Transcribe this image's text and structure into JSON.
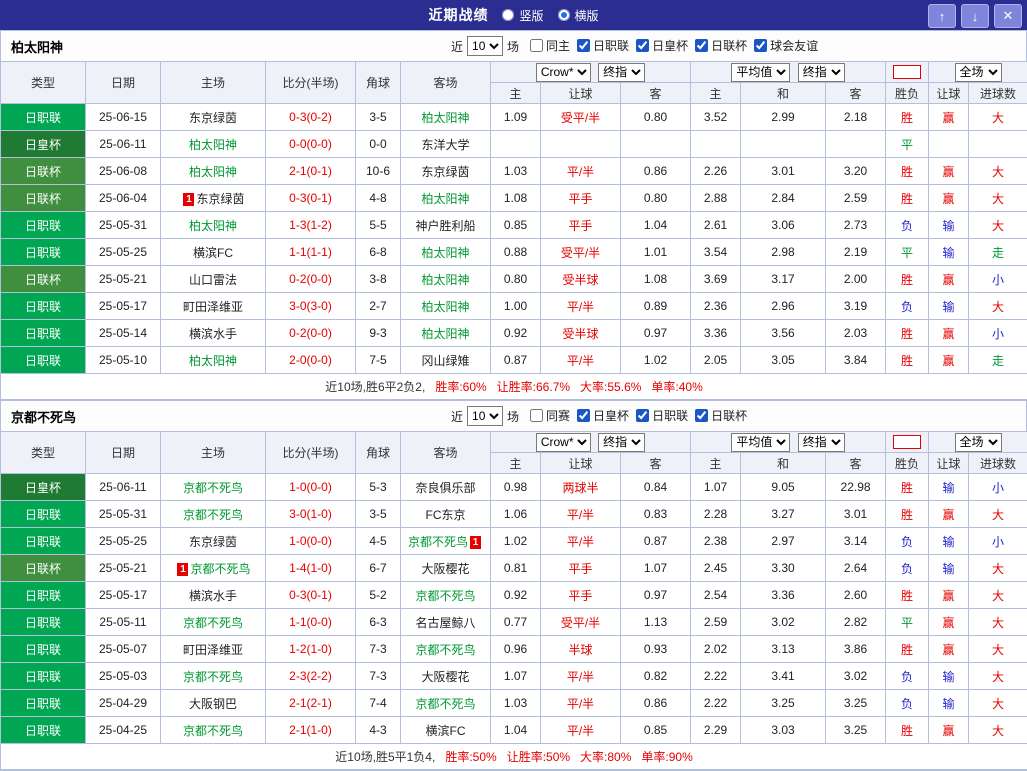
{
  "titlebar": {
    "title": "近期战绩",
    "vertical_label": "竖版",
    "horizontal_label": "横版",
    "up_icon": "↑",
    "down_icon": "↓",
    "close_icon": "✕"
  },
  "filter_labels": {
    "near": "近",
    "matches": "场"
  },
  "table_header": {
    "col_type": "类型",
    "col_date": "日期",
    "col_home": "主场",
    "col_score": "比分(半场)",
    "col_corner": "角球",
    "col_away": "客场",
    "odds_source": "Crow*",
    "odds_stage": "终指",
    "avg_source": "平均值",
    "avg_stage": "终指",
    "scope": "全场",
    "sub_home": "主",
    "sub_handicap": "让球",
    "sub_away": "客",
    "sub_home2": "主",
    "sub_draw": "和",
    "sub_away2": "客",
    "col_result": "胜负",
    "col_handicap_result": "让球",
    "col_goals": "进球数"
  },
  "badge_text": "1",
  "colors": {
    "text": "#222222",
    "league": {
      "日职联": "#00a651",
      "日皇杯": "#1f7a33",
      "日联杯": "#3f8f3f"
    },
    "focus_team": "#009933",
    "team": "#222222",
    "score": "#e60000",
    "handicap_line": "#e60000",
    "result": {
      "胜": "#e60000",
      "平": "#009933",
      "负": "#2323cc"
    },
    "cover": {
      "赢": "#e60000",
      "输": "#2323cc"
    },
    "goals": {
      "大": "#e60000",
      "小": "#2323cc",
      "走": "#009933"
    }
  },
  "sections": [
    {
      "team": "柏太阳神",
      "filter": {
        "count": "10",
        "checkboxes": [
          {
            "label": "同主",
            "checked": false
          },
          {
            "label": "日职联",
            "checked": true
          },
          {
            "label": "日皇杯",
            "checked": true
          },
          {
            "label": "日联杯",
            "checked": true
          },
          {
            "label": "球会友谊",
            "checked": true
          }
        ]
      },
      "rows": [
        {
          "league": "日职联",
          "date": "25-06-15",
          "home": "东京绿茵",
          "home_focus": false,
          "home_badge": null,
          "score": "0-3(0-2)",
          "corners": "3-5",
          "away": "柏太阳神",
          "away_focus": true,
          "away_badge": null,
          "odds": [
            "1.09",
            "受平/半",
            "0.80"
          ],
          "avg": [
            "3.52",
            "2.99",
            "2.18"
          ],
          "result": "胜",
          "cover": "赢",
          "goals": "大"
        },
        {
          "league": "日皇杯",
          "date": "25-06-11",
          "home": "柏太阳神",
          "home_focus": true,
          "home_badge": null,
          "score": "0-0(0-0)",
          "corners": "0-0",
          "away": "东洋大学",
          "away_focus": false,
          "away_badge": null,
          "odds": [
            "",
            "",
            ""
          ],
          "avg": [
            "",
            "",
            ""
          ],
          "result": "平",
          "cover": "",
          "goals": ""
        },
        {
          "league": "日联杯",
          "date": "25-06-08",
          "home": "柏太阳神",
          "home_focus": true,
          "home_badge": null,
          "score": "2-1(0-1)",
          "corners": "10-6",
          "away": "东京绿茵",
          "away_focus": false,
          "away_badge": null,
          "odds": [
            "1.03",
            "平/半",
            "0.86"
          ],
          "avg": [
            "2.26",
            "3.01",
            "3.20"
          ],
          "result": "胜",
          "cover": "赢",
          "goals": "大"
        },
        {
          "league": "日联杯",
          "date": "25-06-04",
          "home": "东京绿茵",
          "home_focus": false,
          "home_badge": "before",
          "score": "0-3(0-1)",
          "corners": "4-8",
          "away": "柏太阳神",
          "away_focus": true,
          "away_badge": null,
          "odds": [
            "1.08",
            "平手",
            "0.80"
          ],
          "avg": [
            "2.88",
            "2.84",
            "2.59"
          ],
          "result": "胜",
          "cover": "赢",
          "goals": "大"
        },
        {
          "league": "日职联",
          "date": "25-05-31",
          "home": "柏太阳神",
          "home_focus": true,
          "home_badge": null,
          "score": "1-3(1-2)",
          "corners": "5-5",
          "away": "神户胜利船",
          "away_focus": false,
          "away_badge": null,
          "odds": [
            "0.85",
            "平手",
            "1.04"
          ],
          "avg": [
            "2.61",
            "3.06",
            "2.73"
          ],
          "result": "负",
          "cover": "输",
          "goals": "大"
        },
        {
          "league": "日职联",
          "date": "25-05-25",
          "home": "横滨FC",
          "home_focus": false,
          "home_badge": null,
          "score": "1-1(1-1)",
          "corners": "6-8",
          "away": "柏太阳神",
          "away_focus": true,
          "away_badge": null,
          "odds": [
            "0.88",
            "受平/半",
            "1.01"
          ],
          "avg": [
            "3.54",
            "2.98",
            "2.19"
          ],
          "result": "平",
          "cover": "输",
          "goals": "走"
        },
        {
          "league": "日联杯",
          "date": "25-05-21",
          "home": "山口雷法",
          "home_focus": false,
          "home_badge": null,
          "score": "0-2(0-0)",
          "corners": "3-8",
          "away": "柏太阳神",
          "away_focus": true,
          "away_badge": null,
          "odds": [
            "0.80",
            "受半球",
            "1.08"
          ],
          "avg": [
            "3.69",
            "3.17",
            "2.00"
          ],
          "result": "胜",
          "cover": "赢",
          "goals": "小"
        },
        {
          "league": "日职联",
          "date": "25-05-17",
          "home": "町田泽维亚",
          "home_focus": false,
          "home_badge": null,
          "score": "3-0(3-0)",
          "corners": "2-7",
          "away": "柏太阳神",
          "away_focus": true,
          "away_badge": null,
          "odds": [
            "1.00",
            "平/半",
            "0.89"
          ],
          "avg": [
            "2.36",
            "2.96",
            "3.19"
          ],
          "result": "负",
          "cover": "输",
          "goals": "大"
        },
        {
          "league": "日职联",
          "date": "25-05-14",
          "home": "横滨水手",
          "home_focus": false,
          "home_badge": null,
          "score": "0-2(0-0)",
          "corners": "9-3",
          "away": "柏太阳神",
          "away_focus": true,
          "away_badge": null,
          "odds": [
            "0.92",
            "受半球",
            "0.97"
          ],
          "avg": [
            "3.36",
            "3.56",
            "2.03"
          ],
          "result": "胜",
          "cover": "赢",
          "goals": "小"
        },
        {
          "league": "日职联",
          "date": "25-05-10",
          "home": "柏太阳神",
          "home_focus": true,
          "home_badge": null,
          "score": "2-0(0-0)",
          "corners": "7-5",
          "away": "冈山绿雉",
          "away_focus": false,
          "away_badge": null,
          "odds": [
            "0.87",
            "平/半",
            "1.02"
          ],
          "avg": [
            "2.05",
            "3.05",
            "3.84"
          ],
          "result": "胜",
          "cover": "赢",
          "goals": "走"
        }
      ],
      "summary": {
        "prefix": "近10场,胜6平2负2,",
        "stats": [
          "胜率:60%",
          "让胜率:66.7%",
          "大率:55.6%",
          "单率:40%"
        ]
      }
    },
    {
      "team": "京都不死鸟",
      "filter": {
        "count": "10",
        "checkboxes": [
          {
            "label": "同赛",
            "checked": false
          },
          {
            "label": "日皇杯",
            "checked": true
          },
          {
            "label": "日职联",
            "checked": true
          },
          {
            "label": "日联杯",
            "checked": true
          }
        ]
      },
      "rows": [
        {
          "league": "日皇杯",
          "date": "25-06-11",
          "home": "京都不死鸟",
          "home_focus": true,
          "home_badge": null,
          "score": "1-0(0-0)",
          "corners": "5-3",
          "away": "奈良俱乐部",
          "away_focus": false,
          "away_badge": null,
          "odds": [
            "0.98",
            "两球半",
            "0.84"
          ],
          "avg": [
            "1.07",
            "9.05",
            "22.98"
          ],
          "result": "胜",
          "cover": "输",
          "goals": "小"
        },
        {
          "league": "日职联",
          "date": "25-05-31",
          "home": "京都不死鸟",
          "home_focus": true,
          "home_badge": null,
          "score": "3-0(1-0)",
          "corners": "3-5",
          "away": "FC东京",
          "away_focus": false,
          "away_badge": null,
          "odds": [
            "1.06",
            "平/半",
            "0.83"
          ],
          "avg": [
            "2.28",
            "3.27",
            "3.01"
          ],
          "result": "胜",
          "cover": "赢",
          "goals": "大"
        },
        {
          "league": "日职联",
          "date": "25-05-25",
          "home": "东京绿茵",
          "home_focus": false,
          "home_badge": null,
          "score": "1-0(0-0)",
          "corners": "4-5",
          "away": "京都不死鸟",
          "away_focus": true,
          "away_badge": "after",
          "odds": [
            "1.02",
            "平/半",
            "0.87"
          ],
          "avg": [
            "2.38",
            "2.97",
            "3.14"
          ],
          "result": "负",
          "cover": "输",
          "goals": "小"
        },
        {
          "league": "日联杯",
          "date": "25-05-21",
          "home": "京都不死鸟",
          "home_focus": true,
          "home_badge": "before",
          "score": "1-4(1-0)",
          "corners": "6-7",
          "away": "大阪樱花",
          "away_focus": false,
          "away_badge": null,
          "odds": [
            "0.81",
            "平手",
            "1.07"
          ],
          "avg": [
            "2.45",
            "3.30",
            "2.64"
          ],
          "result": "负",
          "cover": "输",
          "goals": "大"
        },
        {
          "league": "日职联",
          "date": "25-05-17",
          "home": "横滨水手",
          "home_focus": false,
          "home_badge": null,
          "score": "0-3(0-1)",
          "corners": "5-2",
          "away": "京都不死鸟",
          "away_focus": true,
          "away_badge": null,
          "odds": [
            "0.92",
            "平手",
            "0.97"
          ],
          "avg": [
            "2.54",
            "3.36",
            "2.60"
          ],
          "result": "胜",
          "cover": "赢",
          "goals": "大"
        },
        {
          "league": "日职联",
          "date": "25-05-11",
          "home": "京都不死鸟",
          "home_focus": true,
          "home_badge": null,
          "score": "1-1(0-0)",
          "corners": "6-3",
          "away": "名古屋鲸八",
          "away_focus": false,
          "away_badge": null,
          "odds": [
            "0.77",
            "受平/半",
            "1.13"
          ],
          "avg": [
            "2.59",
            "3.02",
            "2.82"
          ],
          "result": "平",
          "cover": "赢",
          "goals": "大"
        },
        {
          "league": "日职联",
          "date": "25-05-07",
          "home": "町田泽维亚",
          "home_focus": false,
          "home_badge": null,
          "score": "1-2(1-0)",
          "corners": "7-3",
          "away": "京都不死鸟",
          "away_focus": true,
          "away_badge": null,
          "odds": [
            "0.96",
            "半球",
            "0.93"
          ],
          "avg": [
            "2.02",
            "3.13",
            "3.86"
          ],
          "result": "胜",
          "cover": "赢",
          "goals": "大"
        },
        {
          "league": "日职联",
          "date": "25-05-03",
          "home": "京都不死鸟",
          "home_focus": true,
          "home_badge": null,
          "score": "2-3(2-2)",
          "corners": "7-3",
          "away": "大阪樱花",
          "away_focus": false,
          "away_badge": null,
          "odds": [
            "1.07",
            "平/半",
            "0.82"
          ],
          "avg": [
            "2.22",
            "3.41",
            "3.02"
          ],
          "result": "负",
          "cover": "输",
          "goals": "大"
        },
        {
          "league": "日职联",
          "date": "25-04-29",
          "home": "大阪钢巴",
          "home_focus": false,
          "home_badge": null,
          "score": "2-1(2-1)",
          "corners": "7-4",
          "away": "京都不死鸟",
          "away_focus": true,
          "away_badge": null,
          "odds": [
            "1.03",
            "平/半",
            "0.86"
          ],
          "avg": [
            "2.22",
            "3.25",
            "3.25"
          ],
          "result": "负",
          "cover": "输",
          "goals": "大"
        },
        {
          "league": "日职联",
          "date": "25-04-25",
          "home": "京都不死鸟",
          "home_focus": true,
          "home_badge": null,
          "score": "2-1(1-0)",
          "corners": "4-3",
          "away": "横滨FC",
          "away_focus": false,
          "away_badge": null,
          "odds": [
            "1.04",
            "平/半",
            "0.85"
          ],
          "avg": [
            "2.29",
            "3.03",
            "3.25"
          ],
          "result": "胜",
          "cover": "赢",
          "goals": "大"
        }
      ],
      "summary": {
        "prefix": "近10场,胜5平1负4,",
        "stats": [
          "胜率:50%",
          "让胜率:50%",
          "大率:80%",
          "单率:90%"
        ]
      }
    }
  ]
}
